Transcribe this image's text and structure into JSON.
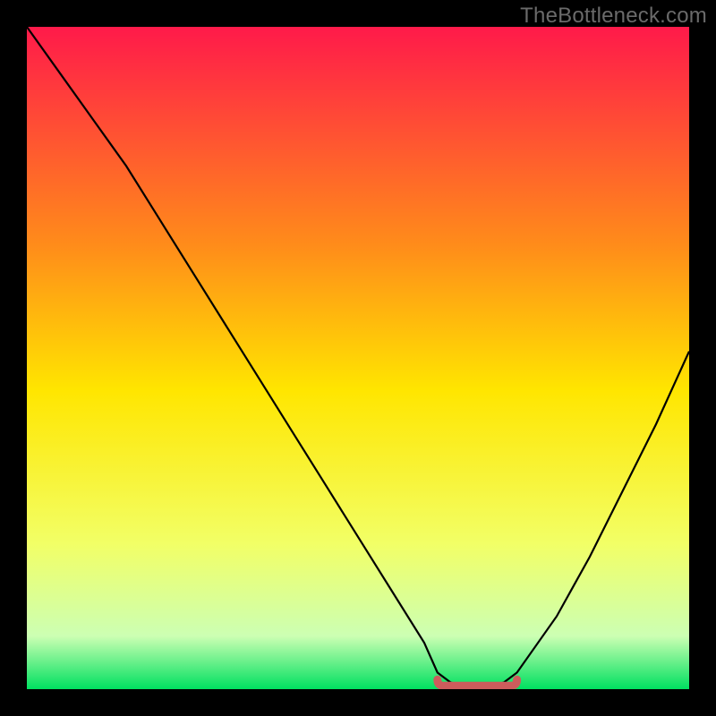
{
  "watermark": "TheBottleneck.com",
  "colors": {
    "background": "#000000",
    "curve": "#000000",
    "marker": "#cd5c5c",
    "gradient_top": "#ff1a4a",
    "gradient_mid_upper": "#ff8c1a",
    "gradient_mid": "#ffe600",
    "gradient_mid_lower": "#f2ff66",
    "gradient_lower": "#ccffb3",
    "gradient_bottom": "#00e060"
  },
  "chart_data": {
    "type": "line",
    "title": "",
    "xlabel": "",
    "ylabel": "",
    "xlim": [
      0,
      100
    ],
    "ylim": [
      0,
      100
    ],
    "x": [
      0,
      5,
      10,
      15,
      20,
      25,
      30,
      35,
      40,
      45,
      50,
      55,
      60,
      62,
      64,
      66,
      68,
      70,
      72,
      74,
      80,
      85,
      90,
      95,
      100
    ],
    "values": [
      100,
      93,
      86,
      79,
      71,
      63,
      55,
      47,
      39,
      31,
      23,
      15,
      7,
      2.5,
      1,
      0.5,
      0.5,
      0.5,
      1,
      2.5,
      11,
      20,
      30,
      40,
      51
    ],
    "optimum_marker": {
      "x_start": 62,
      "x_end": 74,
      "y": 0.5
    },
    "annotations": []
  }
}
